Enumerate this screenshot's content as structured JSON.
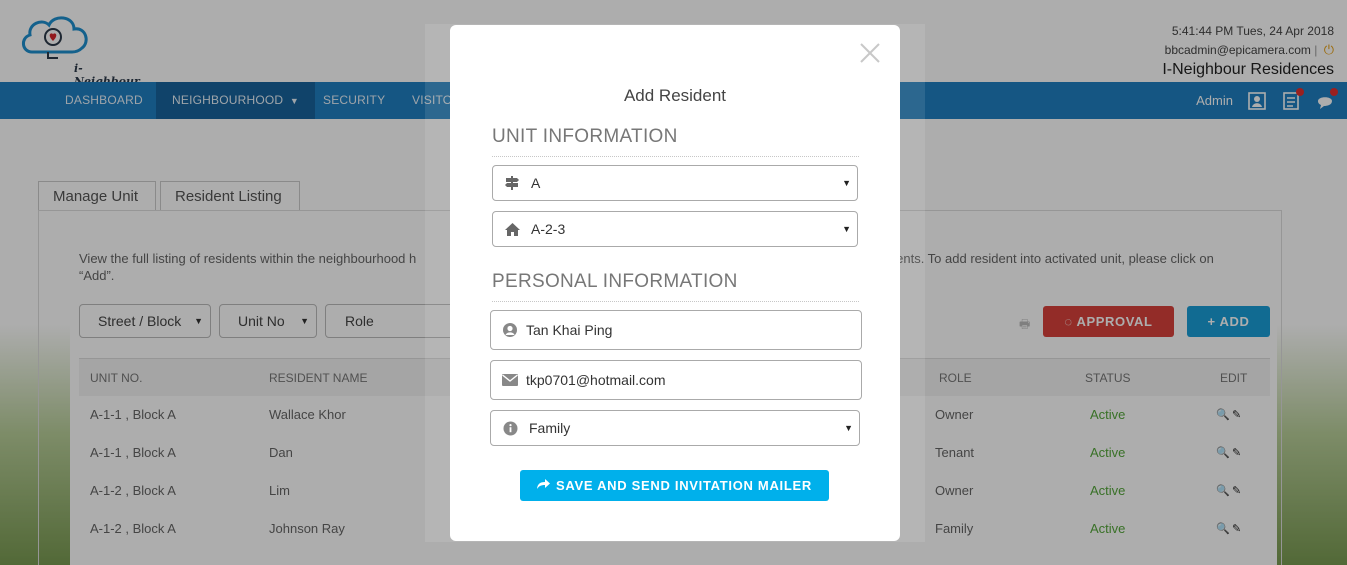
{
  "header": {
    "logo_text": "i-Neighbour",
    "clock": "5:41:44 PM  Tues, 24 Apr 2018",
    "user_email": "bbcadmin@epicamera.com",
    "site_name": "I-Neighbour Residences",
    "brand_color": "#1f7fc2"
  },
  "nav": {
    "items": [
      {
        "label": "DASHBOARD"
      },
      {
        "label": "NEIGHBOURHOOD"
      },
      {
        "label": "SECURITY"
      },
      {
        "label": "VISITO"
      }
    ],
    "admin_label": "Admin"
  },
  "tabs": [
    {
      "label": "Manage Unit"
    },
    {
      "label": "Resident Listing"
    }
  ],
  "description": "View the full listing of residents within the neighbourhood h",
  "description_tail": "idents. To add resident into activated unit, please click on",
  "description_line2": "“Add”.",
  "filters": {
    "street_block": "Street / Block",
    "unit_no": "Unit No",
    "role": "Role"
  },
  "buttons": {
    "approval": "APPROVAL",
    "add": "ADD"
  },
  "table": {
    "headers": {
      "unit_no": "UNIT NO.",
      "resident_name": "RESIDENT NAME",
      "role": "ROLE",
      "status": "STATUS",
      "edit": "EDIT"
    },
    "rows": [
      {
        "unit": "A-1-1 , Block A",
        "name": "Wallace Khor",
        "role": "Owner",
        "status": "Active"
      },
      {
        "unit": "A-1-1 , Block A",
        "name": "Dan",
        "role": "Tenant",
        "status": "Active"
      },
      {
        "unit": "A-1-2 , Block A",
        "name": "Lim",
        "role": "Owner",
        "status": "Active"
      },
      {
        "unit": "A-1-2 , Block A",
        "name": "Johnson Ray",
        "role": "Family",
        "status": "Active"
      }
    ],
    "status_color": "#54a73a"
  },
  "modal": {
    "title": "Add Resident",
    "unit_section": "UNIT INFORMATION",
    "personal_section": "PERSONAL INFORMATION",
    "street_value": "A",
    "unit_value": "A-2-3",
    "name_value": "Tan Khai Ping",
    "email_value": "tkp0701@hotmail.com",
    "role_value": "Family",
    "save_label": "SAVE AND SEND INVITATION MAILER",
    "save_color": "#00b0eb"
  }
}
